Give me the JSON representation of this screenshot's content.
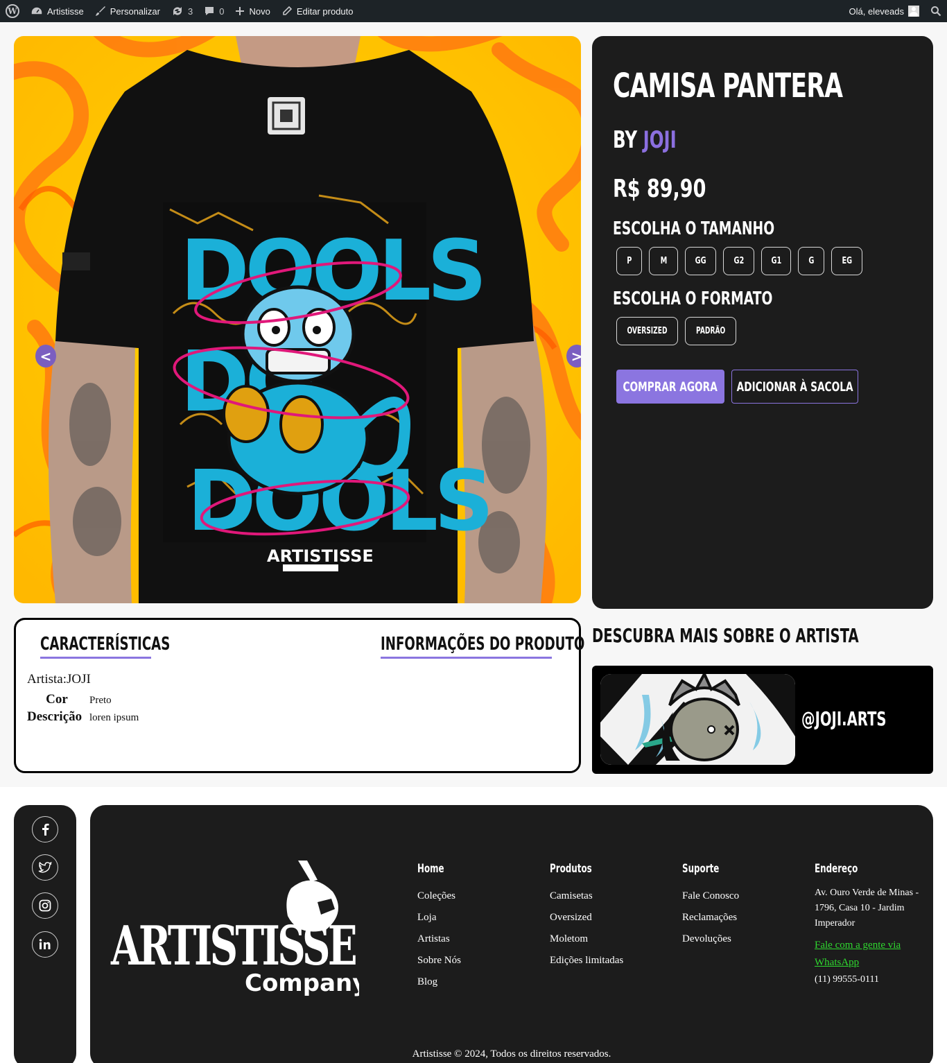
{
  "admin_bar": {
    "site_name": "Artistisse",
    "customize": "Personalizar",
    "updates_count": "3",
    "comments_count": "0",
    "new": "Novo",
    "edit_product": "Editar produto",
    "greeting": "Olá, eleveads"
  },
  "gallery": {
    "prev": "<",
    "next": ">"
  },
  "product": {
    "title": "CAMISA PANTERA",
    "by_prefix": "BY",
    "artist": "JOJI",
    "price": "R$  89,90",
    "size_label": "ESCOLHA O TAMANHO",
    "sizes": [
      "P",
      "M",
      "GG",
      "G2",
      "G1",
      "G",
      "EG"
    ],
    "format_label": "ESCOLHA O FORMATO",
    "formats": [
      "OVERSIZED",
      "PADRÃO"
    ],
    "buy_now": "COMPRAR AGORA",
    "add_to_bag": "ADICIONAR À SACOLA"
  },
  "details": {
    "tab_features": "CARACTERÍSTICAS",
    "tab_info": "INFORMAÇÕES DO PRODUTO",
    "artist_line": "Artista:JOJI",
    "specs": [
      {
        "key": "Cor",
        "value": "Preto"
      },
      {
        "key": "Descrição",
        "value": "loren ipsum"
      }
    ]
  },
  "artist_section": {
    "heading": "DESCUBRA MAIS SOBRE O ARTISTA",
    "handle": "@JOJI.ARTS"
  },
  "footer": {
    "logo_text": "ARTISTISSE",
    "logo_sub": "Company",
    "columns": [
      {
        "title": "Home",
        "links": [
          "Coleções",
          "Loja",
          "Artistas",
          "Sobre Nós",
          "Blog"
        ]
      },
      {
        "title": "Produtos",
        "links": [
          "Camisetas",
          "Oversized",
          "Moletom",
          "Edições limitadas"
        ]
      },
      {
        "title": "Suporte",
        "links": [
          "Fale Conosco",
          "Reclamações",
          "Devoluções"
        ]
      }
    ],
    "address_title": "Endereço",
    "address": "Av. Ouro Verde de Minas - 1796, Casa 10 - Jardim Imperador",
    "whatsapp": "Fale com a gente via WhatsApp",
    "phone": "(11) 99555-0111",
    "copyright": "Artistisse © 2024, Todos os direitos reservados.",
    "social": [
      "facebook-icon",
      "twitter-icon",
      "instagram-icon",
      "linkedin-icon"
    ]
  },
  "colors": {
    "accent": "#8b75e0",
    "dark": "#1c1c1c",
    "whatsapp": "#2fd92f"
  }
}
